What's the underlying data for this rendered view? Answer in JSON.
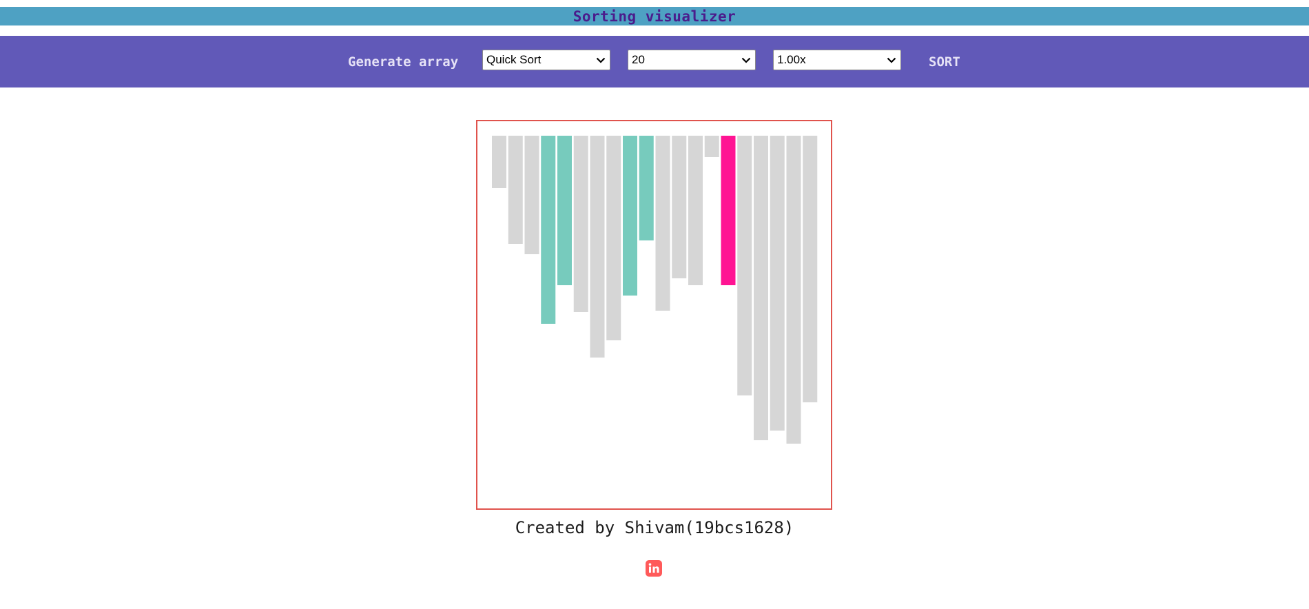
{
  "header": {
    "title": "Sorting visualizer"
  },
  "toolbar": {
    "generate_label": "Generate array",
    "algorithm_value": "Quick Sort",
    "size_value": "20",
    "speed_value": "1.00x",
    "sort_label": "SORT"
  },
  "colors": {
    "title_bar": "#4ea1c3",
    "toolbar": "#6159b8",
    "bar_default": "#d6d6d6",
    "bar_compare": "#77cbbd",
    "bar_pivot": "#ff1493",
    "chart_border": "#e0534d",
    "linkedin": "#ff5a5a"
  },
  "chart_data": {
    "type": "bar",
    "orientation": "hanging-from-top",
    "values": [
      76,
      157,
      172,
      273,
      217,
      256,
      322,
      297,
      232,
      152,
      254,
      207,
      217,
      31,
      217,
      377,
      442,
      428,
      447,
      387
    ],
    "states": [
      "default",
      "default",
      "default",
      "compare",
      "compare",
      "default",
      "default",
      "default",
      "compare",
      "compare",
      "default",
      "default",
      "default",
      "default",
      "pivot",
      "default",
      "default",
      "default",
      "default",
      "default"
    ]
  },
  "footer": {
    "credit": "Created by Shivam(19bcs1628)",
    "linkedin_icon": "linkedin-icon"
  }
}
